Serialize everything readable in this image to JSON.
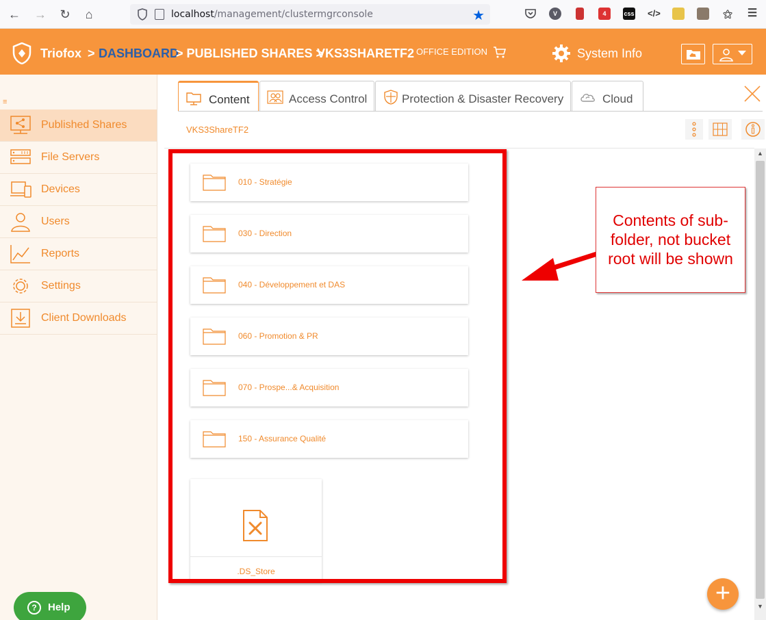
{
  "browser": {
    "url_host": "localhost",
    "url_path": "/management/clustermgrconsole",
    "ext_badge": "4",
    "ext_css": "css"
  },
  "header": {
    "brand": "Triofox",
    "sep1": ">",
    "crumb_dashboard": "DASHBOARD",
    "crumb_shares": "> PUBLISHED SHARES >",
    "crumb_share": "VKS3SHARETF2",
    "edition": "OFFICE EDITION",
    "system_info": "System Info"
  },
  "sidebar": {
    "items": [
      {
        "label": "Published Shares",
        "icon": "share-icon"
      },
      {
        "label": "File Servers",
        "icon": "server-icon"
      },
      {
        "label": "Devices",
        "icon": "devices-icon"
      },
      {
        "label": "Users",
        "icon": "user-icon"
      },
      {
        "label": "Reports",
        "icon": "chart-icon"
      },
      {
        "label": "Settings",
        "icon": "gear-icon"
      },
      {
        "label": "Client Downloads",
        "icon": "download-icon"
      }
    ],
    "help": "Help"
  },
  "tabs": [
    {
      "label": "Content"
    },
    {
      "label": "Access Control"
    },
    {
      "label": "Protection & Disaster Recovery"
    },
    {
      "label": "Cloud"
    }
  ],
  "share_path": "VKS3ShareTF2",
  "folders": [
    "010 - Stratégie",
    "030 - Direction",
    "040 - Développement et DAS",
    "060 - Promotion & PR",
    "070 - Prospe...& Acquisition",
    "150 - Assurance Qualité"
  ],
  "file": {
    "name": ".DS_Store"
  },
  "annotation": {
    "text": "Contents of sub-folder, not bucket root will be shown"
  },
  "colors": {
    "accent": "#f7953c",
    "annotation": "#ee0000",
    "help": "#3ea53e"
  }
}
